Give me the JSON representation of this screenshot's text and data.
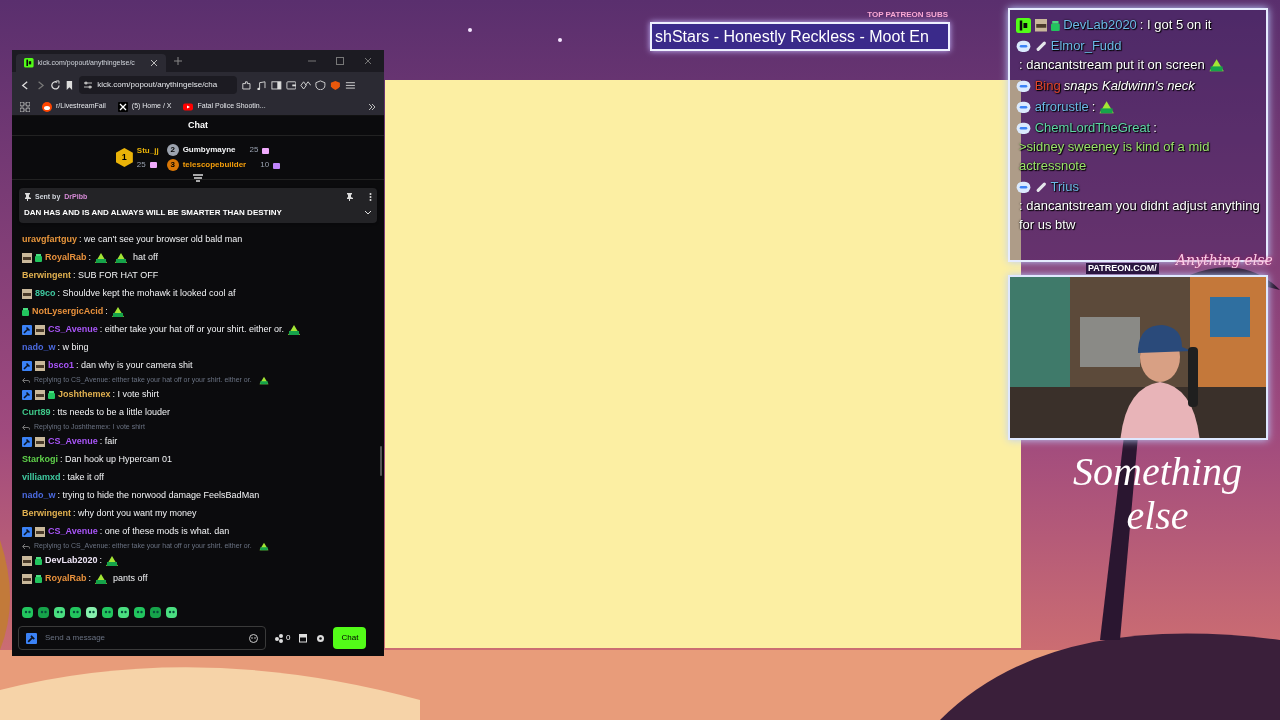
{
  "overlay": {
    "patreon_label": "TOP PATREON SUBS",
    "patreon_ticker": "shStars - Honestly Reckless - Moot En",
    "patreon_url": "PATREON.COM/",
    "logo": "Anything else",
    "tagline": "Something else"
  },
  "overlay_chat": [
    {
      "user": "DevLab2020",
      "color": "#6cb8e6",
      "badges": [
        {
          "kind": "kick"
        },
        {
          "kind": "avatar"
        },
        {
          "kind": "gift"
        }
      ],
      "parts": [
        {
          "kind": "text",
          "text": ": I got 5 on it"
        }
      ]
    },
    {
      "user": "Elmor_Fudd",
      "color": "#6cb8e6",
      "badges": [
        {
          "kind": "bubble"
        },
        {
          "kind": "link"
        }
      ],
      "parts": [
        {
          "kind": "text",
          "text": ": dancantstream put it on screen"
        },
        {
          "kind": "emote"
        }
      ]
    },
    {
      "user": "Bing",
      "color": "#e2452b",
      "badges": [
        {
          "kind": "bubble"
        }
      ],
      "parts": [
        {
          "kind": "action",
          "text": " snaps Kaldwinn's neck"
        }
      ]
    },
    {
      "user": "afrorustle",
      "color": "#6cb8e6",
      "badges": [
        {
          "kind": "bubble"
        }
      ],
      "parts": [
        {
          "kind": "text",
          "text": ":"
        },
        {
          "kind": "emote"
        }
      ]
    },
    {
      "user": "ChemLordTheGreat",
      "color": "#5fd6a6",
      "badges": [
        {
          "kind": "bubble"
        }
      ],
      "parts": [
        {
          "kind": "text",
          "text": ":"
        },
        {
          "kind": "greentext",
          "text": " >sidney sweeney is kind of a mid actressnote"
        }
      ]
    },
    {
      "user": "Trius",
      "color": "#6cb8e6",
      "badges": [
        {
          "kind": "bubble"
        },
        {
          "kind": "link"
        }
      ],
      "parts": [
        {
          "kind": "text",
          "text": ": dancantstream you didnt adjust anything for us btw"
        }
      ]
    }
  ],
  "browser": {
    "tab_title": "kick.com/popout/anythingelse/c",
    "url": "kick.com/popout/anythingelse/cha",
    "bookmarks": [
      {
        "kind": "reddit",
        "label": "r/LivestreamFail"
      },
      {
        "kind": "x",
        "label": "(5) Home / X"
      },
      {
        "kind": "youtube",
        "label": "Fatal Police Shootin..."
      }
    ]
  },
  "chat": {
    "title": "Chat",
    "leaderboard": [
      {
        "rank": "1",
        "name": "Stu_jj",
        "count": "25",
        "color": "#eab308"
      },
      {
        "rank": "2",
        "name": "Gumbymayne",
        "count": "25",
        "color": "#f3f4f6"
      },
      {
        "rank": "3",
        "name": "telescopebuilder",
        "count": "10",
        "color": "#f59e0b"
      }
    ],
    "pinned": {
      "prefix": "Sent by",
      "user": "DrPibb",
      "text": "DAN HAS AND IS AND ALWAYS WILL BE SMARTER THAN DESTINY"
    },
    "messages": [
      {
        "user": "uravgfartguy",
        "color": "#e8963c",
        "parts": [
          {
            "kind": "text",
            "text": ": we can't see your browser old bald man"
          }
        ]
      },
      {
        "user": "RoyalRab",
        "color": "#e8913c",
        "badges": [
          {
            "kind": "avatar"
          },
          {
            "kind": "gift"
          }
        ],
        "parts": [
          {
            "kind": "text",
            "text": ":"
          },
          {
            "kind": "emote"
          },
          {
            "kind": "emote"
          },
          {
            "kind": "text",
            "text": "hat off"
          }
        ]
      },
      {
        "user": "Berwingent",
        "color": "#e0b050",
        "parts": [
          {
            "kind": "text",
            "text": ": SUB FOR HAT OFF"
          }
        ]
      },
      {
        "user": "89co",
        "color": "#3fc9a0",
        "badges": [
          {
            "kind": "avatar"
          }
        ],
        "parts": [
          {
            "kind": "text",
            "text": ": Shouldve kept the mohawk it looked cool af"
          }
        ]
      },
      {
        "user": "NotLysergicAcid",
        "color": "#e8913c",
        "badges": [
          {
            "kind": "gift"
          }
        ],
        "parts": [
          {
            "kind": "text",
            "text": ":"
          },
          {
            "kind": "emote"
          }
        ]
      },
      {
        "user": "CS_Avenue",
        "color": "#a855f7",
        "badges": [
          {
            "kind": "mod"
          },
          {
            "kind": "avatar"
          }
        ],
        "parts": [
          {
            "kind": "text",
            "text": ": either take your hat off or your shirt. either or."
          },
          {
            "kind": "emote"
          }
        ]
      },
      {
        "user": "nado_w",
        "color": "#4b6ae0",
        "parts": [
          {
            "kind": "text",
            "text": ": w bing"
          }
        ]
      },
      {
        "user": "bsco1",
        "color": "#a855f7",
        "badges": [
          {
            "kind": "mod"
          },
          {
            "kind": "avatar"
          }
        ],
        "parts": [
          {
            "kind": "text",
            "text": ": dan why is your camera shit"
          }
        ]
      },
      {
        "user": "Joshthemex",
        "color": "#e0b050",
        "badges": [
          {
            "kind": "mod"
          },
          {
            "kind": "avatar"
          },
          {
            "kind": "gift"
          }
        ],
        "reply": [
          {
            "kind": "text",
            "text": "Replying to CS_Avenue: either take your hat off or your shirt. either or."
          },
          {
            "kind": "emote"
          }
        ],
        "parts": [
          {
            "kind": "text",
            "text": ": I vote shirt"
          }
        ]
      },
      {
        "user": "Curt89",
        "color": "#3fc98a",
        "parts": [
          {
            "kind": "text",
            "text": ": tts needs to be a little louder"
          }
        ]
      },
      {
        "user": "CS_Avenue",
        "color": "#a855f7",
        "badges": [
          {
            "kind": "mod"
          },
          {
            "kind": "avatar"
          }
        ],
        "reply": [
          {
            "kind": "text",
            "text": "Replying to Joshthemex: I vote shirt"
          }
        ],
        "parts": [
          {
            "kind": "text",
            "text": ": fair"
          }
        ]
      },
      {
        "user": "Starkogi",
        "color": "#5fd04a",
        "parts": [
          {
            "kind": "text",
            "text": ": Dan hook up Hypercam 01"
          }
        ]
      },
      {
        "user": "villiamxd",
        "color": "#3fc9a0",
        "parts": [
          {
            "kind": "text",
            "text": ": take it off"
          }
        ]
      },
      {
        "user": "nado_w",
        "color": "#4b6ae0",
        "parts": [
          {
            "kind": "text",
            "text": ": trying to hide the norwood damage FeelsBadMan"
          }
        ]
      },
      {
        "user": "Berwingent",
        "color": "#e0b050",
        "parts": [
          {
            "kind": "text",
            "text": ": why dont you want my money"
          }
        ]
      },
      {
        "user": "CS_Avenue",
        "color": "#a855f7",
        "badges": [
          {
            "kind": "mod"
          },
          {
            "kind": "avatar"
          }
        ],
        "parts": [
          {
            "kind": "text",
            "text": ": one of these mods is what. dan"
          }
        ]
      },
      {
        "user": "DevLab2020",
        "color": "#ede4f5",
        "badges": [
          {
            "kind": "avatar"
          },
          {
            "kind": "gift"
          }
        ],
        "reply": [
          {
            "kind": "text",
            "text": "Replying to CS_Avenue: either take your hat off or your shirt. either or."
          },
          {
            "kind": "emote"
          }
        ],
        "parts": [
          {
            "kind": "text",
            "text": ":"
          },
          {
            "kind": "emote"
          }
        ]
      },
      {
        "user": "RoyalRab",
        "color": "#e8913c",
        "badges": [
          {
            "kind": "avatar"
          },
          {
            "kind": "gift"
          }
        ],
        "parts": [
          {
            "kind": "text",
            "text": ":"
          },
          {
            "kind": "emote"
          },
          {
            "kind": "text",
            "text": "pants off"
          }
        ]
      }
    ],
    "input": {
      "placeholder": "Send a message"
    },
    "points": "0",
    "send": "Chat"
  }
}
